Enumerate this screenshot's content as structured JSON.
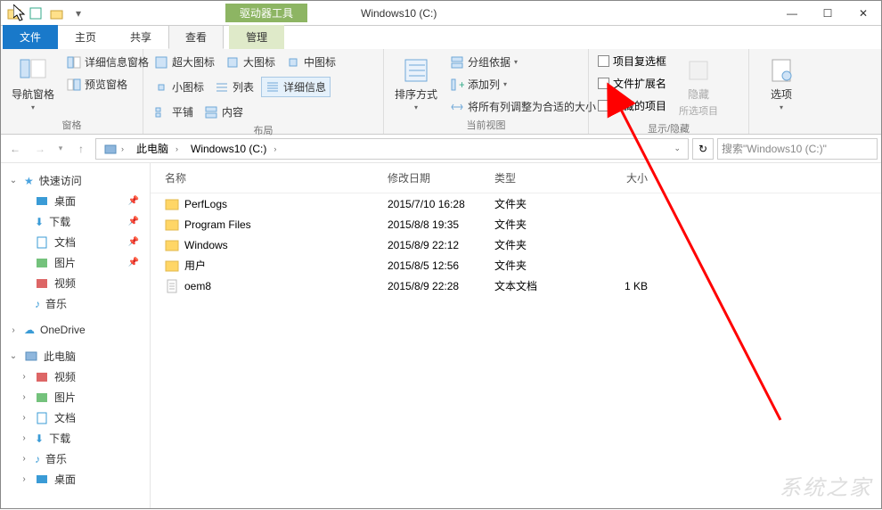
{
  "titlebar": {
    "context_tab": "驱动器工具",
    "title": "Windows10 (C:)"
  },
  "tabs": {
    "file": "文件",
    "home": "主页",
    "share": "共享",
    "view": "查看",
    "manage": "管理"
  },
  "ribbon": {
    "panes": {
      "nav_pane": "导航窗格",
      "details_pane": "详细信息窗格",
      "preview_pane": "预览窗格",
      "label": "窗格"
    },
    "layout": {
      "extra_large": "超大图标",
      "large": "大图标",
      "medium": "中图标",
      "small": "小图标",
      "list": "列表",
      "details": "详细信息",
      "tiles": "平铺",
      "content": "内容",
      "label": "布局"
    },
    "current_view": {
      "sort_by": "排序方式",
      "group_by": "分组依据",
      "add_columns": "添加列",
      "size_columns": "将所有列调整为合适的大小",
      "label": "当前视图"
    },
    "show_hide": {
      "item_checkboxes": "项目复选框",
      "file_ext": "文件扩展名",
      "hidden_items": "隐藏的项目",
      "hide_selected": "隐藏",
      "hide_selected_sub": "所选项目",
      "label": "显示/隐藏"
    },
    "options": "选项"
  },
  "breadcrumb": {
    "this_pc": "此电脑",
    "drive": "Windows10 (C:)"
  },
  "search_placeholder": "搜索\"Windows10 (C:)\"",
  "nav": {
    "quick_access": "快速访问",
    "desktop": "桌面",
    "downloads": "下载",
    "documents": "文档",
    "pictures": "图片",
    "videos": "视频",
    "music": "音乐",
    "onedrive": "OneDrive",
    "this_pc": "此电脑",
    "videos2": "视频",
    "pictures2": "图片",
    "documents2": "文档",
    "downloads2": "下载",
    "music2": "音乐",
    "desktop2": "桌面"
  },
  "file_headers": {
    "name": "名称",
    "date": "修改日期",
    "type": "类型",
    "size": "大小"
  },
  "files": [
    {
      "icon": "folder",
      "name": "PerfLogs",
      "date": "2015/7/10 16:28",
      "type": "文件夹",
      "size": ""
    },
    {
      "icon": "folder",
      "name": "Program Files",
      "date": "2015/8/8 19:35",
      "type": "文件夹",
      "size": ""
    },
    {
      "icon": "folder",
      "name": "Windows",
      "date": "2015/8/9 22:12",
      "type": "文件夹",
      "size": ""
    },
    {
      "icon": "folder",
      "name": "用户",
      "date": "2015/8/5 12:56",
      "type": "文件夹",
      "size": ""
    },
    {
      "icon": "file",
      "name": "oem8",
      "date": "2015/8/9 22:28",
      "type": "文本文档",
      "size": "1 KB"
    }
  ],
  "watermark": "系统之家"
}
